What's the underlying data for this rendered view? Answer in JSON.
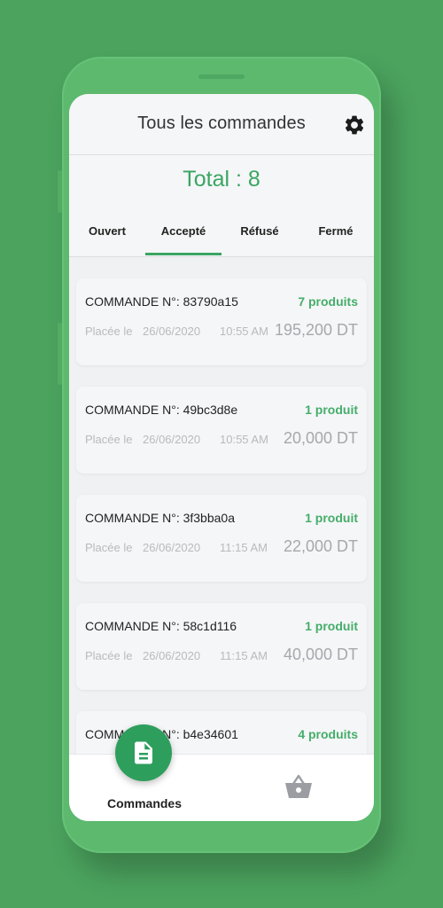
{
  "header": {
    "title": "Tous les commandes",
    "settings_icon": "gear-icon"
  },
  "summary": {
    "total": "Total : 8"
  },
  "tabs": [
    {
      "label": "Ouvert"
    },
    {
      "label": "Accepté",
      "active": true
    },
    {
      "label": "Réfusé"
    },
    {
      "label": "Fermé"
    }
  ],
  "orders": [
    {
      "id": "COMMANDE N°: 83790a15",
      "count": "7 produits",
      "placed": "Placée le",
      "date": "26/06/2020",
      "time": "10:55 AM",
      "price": "195,200 DT"
    },
    {
      "id": "COMMANDE N°: 49bc3d8e",
      "count": "1 produit",
      "placed": "Placée le",
      "date": "26/06/2020",
      "time": "10:55 AM",
      "price": "20,000 DT"
    },
    {
      "id": "COMMANDE N°: 3f3bba0a",
      "count": "1 produit",
      "placed": "Placée le",
      "date": "26/06/2020",
      "time": "11:15 AM",
      "price": "22,000 DT"
    },
    {
      "id": "COMMANDE N°: 58c1d116",
      "count": "1 produit",
      "placed": "Placée le",
      "date": "26/06/2020",
      "time": "11:15 AM",
      "price": "40,000 DT"
    },
    {
      "id": "COMMANDE N°: b4e34601",
      "count": "4 produits",
      "placed": "",
      "date": "",
      "time": "",
      "price": ""
    }
  ],
  "bottom_nav": {
    "commandes_label": "Commandes",
    "commandes_icon": "document-icon",
    "basket_icon": "basket-icon"
  },
  "colors": {
    "accent": "#3aa563",
    "background": "#4ba35e",
    "fab": "#2e9e5c"
  }
}
